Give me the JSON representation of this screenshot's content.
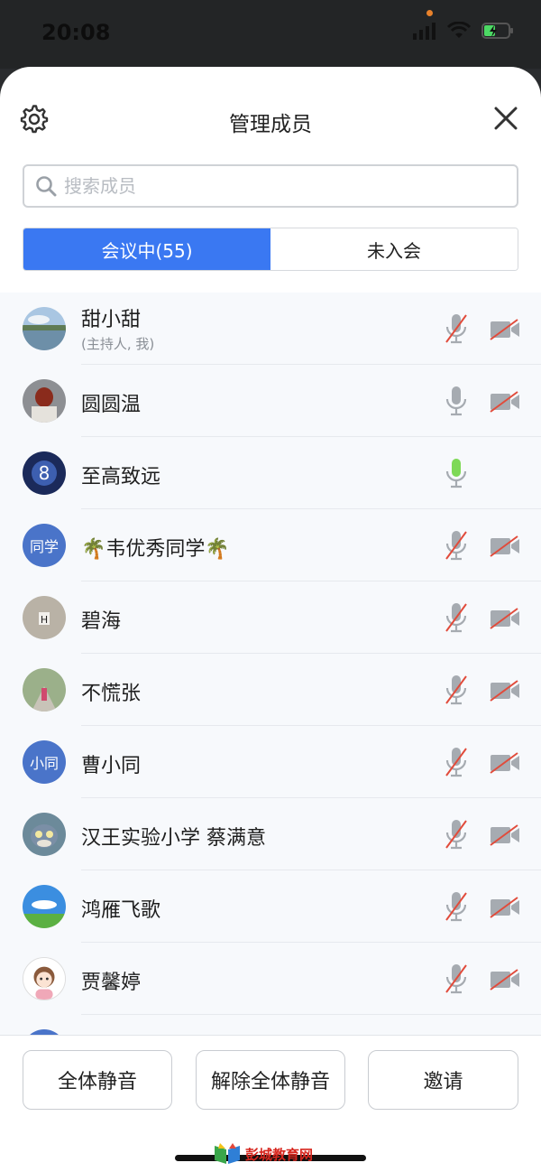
{
  "status": {
    "time": "20:08"
  },
  "header": {
    "title": "管理成员"
  },
  "search": {
    "placeholder": "搜索成员"
  },
  "tabs": [
    {
      "label": "会议中(55)",
      "active": true
    },
    {
      "label": "未入会",
      "active": false
    }
  ],
  "members": [
    {
      "name": "甜小甜",
      "sub": "(主持人, 我)",
      "avatar": "landscape-photo",
      "mic": "muted",
      "cam": "off"
    },
    {
      "name": "圆圆温",
      "sub": "",
      "avatar": "portrait-photo",
      "mic": "on-gray",
      "cam": "off"
    },
    {
      "name": "至高致远",
      "sub": "",
      "avatar": "logo-8",
      "mic": "active-green",
      "cam": "none"
    },
    {
      "name": "🌴韦优秀同学🌴",
      "sub": "",
      "avatar_text": "同学",
      "mic": "muted",
      "cam": "off"
    },
    {
      "name": "碧海",
      "sub": "",
      "avatar": "letter-photo",
      "mic": "muted",
      "cam": "off"
    },
    {
      "name": "不慌张",
      "sub": "",
      "avatar": "road-photo",
      "mic": "muted",
      "cam": "off"
    },
    {
      "name": "曹小同",
      "sub": "",
      "avatar_text": "小同",
      "mic": "muted",
      "cam": "off"
    },
    {
      "name": "汉王实验小学 蔡满意",
      "sub": "",
      "avatar": "cartoon-cat",
      "mic": "muted",
      "cam": "off"
    },
    {
      "name": "鸿雁飞歌",
      "sub": "",
      "avatar": "sky-photo",
      "mic": "muted",
      "cam": "off"
    },
    {
      "name": "贾馨婷",
      "sub": "",
      "avatar": "cartoon-girl",
      "mic": "muted",
      "cam": "off"
    }
  ],
  "buttons": {
    "mute_all": "全体静音",
    "unmute_all": "解除全体静音",
    "invite": "邀请"
  },
  "watermark": "彭城教育网",
  "colors": {
    "accent": "#3a78f2",
    "muted_red": "#e14b3b",
    "mic_green": "#7ed957",
    "avatar_blue": "#4a74c9"
  }
}
